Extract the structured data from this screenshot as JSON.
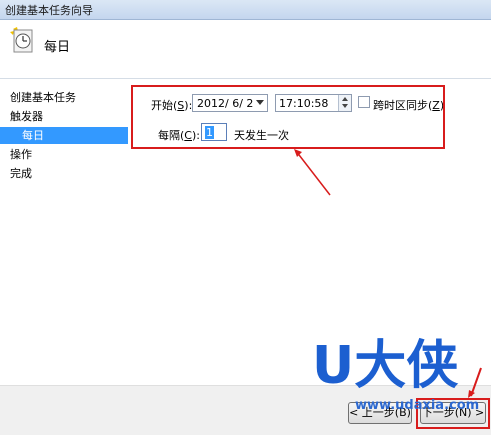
{
  "window": {
    "title": "创建基本任务向导"
  },
  "header": {
    "title": "每日"
  },
  "sidebar": {
    "items": [
      {
        "label": "创建基本任务"
      },
      {
        "label": "触发器"
      },
      {
        "label": "每日"
      },
      {
        "label": "操作"
      },
      {
        "label": "完成"
      }
    ]
  },
  "form": {
    "start_label": "开始",
    "start_accel": "S",
    "date_value": "2012/ 6/ 2",
    "time_value": "17:10:58",
    "sync_label": "跨时区同步",
    "sync_accel": "Z",
    "sync_checked": false,
    "recur_label": "每隔",
    "recur_accel": "C",
    "recur_value": "1",
    "recur_suffix": "天发生一次"
  },
  "footer": {
    "back_label": "< 上一步(B)",
    "next_label": "下一步(N) >"
  },
  "watermark": {
    "text": "U大侠",
    "url": "www.udaxia.com"
  },
  "colors": {
    "accent": "#3399ff",
    "annotation_red": "#d81c1c",
    "watermark_blue": "#1c5fd0"
  }
}
